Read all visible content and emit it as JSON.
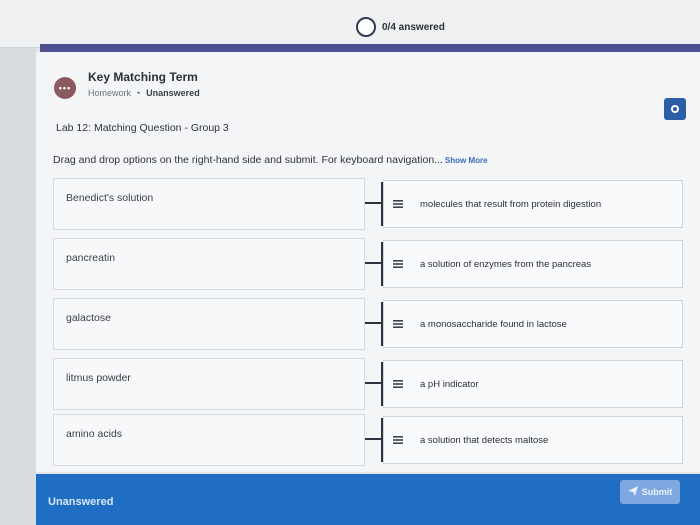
{
  "progress": {
    "label": "0/4 answered",
    "answered": 0,
    "total": 4
  },
  "question": {
    "avatar_icon": "user-avatar-icon",
    "title": "Key Matching Term",
    "category": "Homework",
    "separator": "•",
    "status": "Unanswered",
    "group_title": "Lab 12: Matching Question - Group 3",
    "instructions": "Drag and drop options on the right-hand side and submit. For keyboard navigation...",
    "show_more": "Show More"
  },
  "terms": [
    "Benedict's solution",
    "pancreatin",
    "galactose",
    "litmus powder",
    "amino acids"
  ],
  "options": [
    "molecules that result from protein digestion",
    "a solution of enzymes from the pancreas",
    "a monosaccharide found in lactose",
    "a pH indicator",
    "a solution that detects maltose"
  ],
  "footer": {
    "status": "Unanswered",
    "submit_label": "Submit",
    "submit_icon": "send-icon"
  },
  "colors": {
    "accent": "#4e4f93",
    "footer": "#1f6ec4",
    "primary_button": "#2a5fa8"
  }
}
